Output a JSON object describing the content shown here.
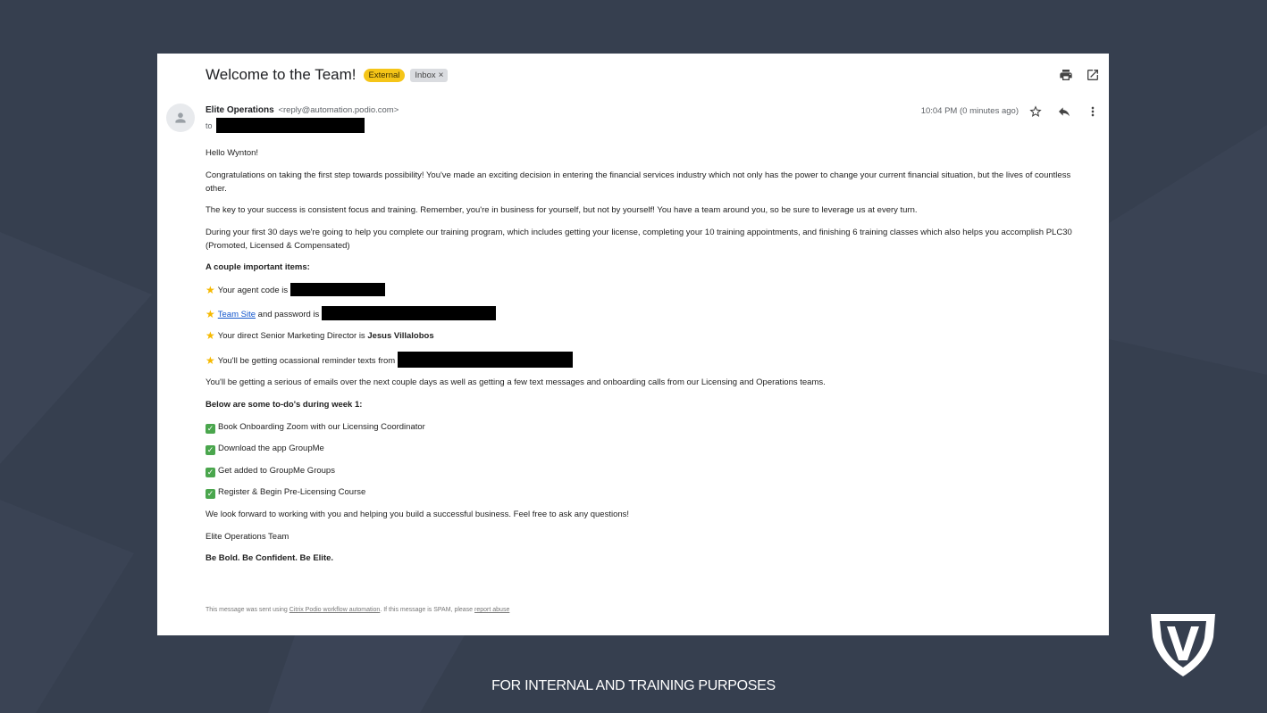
{
  "email": {
    "subject": "Welcome to the Team!",
    "badge_external": "External",
    "badge_inbox": "Inbox",
    "badge_inbox_close": "×",
    "sender_name": "Elite Operations",
    "sender_email": "<reply@automation.podio.com>",
    "to_label": "to",
    "timestamp": "10:04 PM (0 minutes ago)"
  },
  "body": {
    "greeting": "Hello Wynton!",
    "p1": "Congratulations on taking the first step towards possibility! You've made an exciting decision in entering the financial services industry which not only has the power to change your current financial situation, but the lives of countless other.",
    "p2": "The key to your success is consistent focus and training. Remember, you're in business for yourself, but not by yourself! You have a team around you, so be sure to leverage us at every turn.",
    "p3": "During your first 30 days we're going to help you complete our training program, which includes getting your license, completing your 10 training appointments, and finishing 6 training classes which also helps you accomplish PLC30 (Promoted, Licensed & Compensated)",
    "important_heading": "A couple important items:",
    "item_agent_code": "Your agent code is",
    "item_team_site_link": "Team Site",
    "item_team_site_rest": "and password is",
    "item_director_prefix": "Your direct Senior Marketing Director is",
    "item_director_name": "Jesus Villalobos",
    "item_texts": "You'll be getting ocassional reminder texts from",
    "p4": "You'll be getting a serious of emails over the next couple days as well as getting a few text messages and onboarding calls from our Licensing and Operations teams.",
    "todo_heading": "Below are some to-do's during week 1:",
    "todos": [
      "Book Onboarding Zoom with our Licensing Coordinator",
      "Download the app GroupMe",
      "Get added to GroupMe Groups",
      "Register & Begin Pre-Licensing Course"
    ],
    "closing": "We look forward to working with you and helping you build a successful business. Feel free to ask any questions!",
    "signature": "Elite Operations Team",
    "tagline": "Be Bold. Be Confident. Be Elite."
  },
  "footer": {
    "prefix": "This message was sent using",
    "link1": "Citrix Podio workflow automation",
    "middle": ". If this message is SPAM, please",
    "link2": "report abuse"
  },
  "caption": "FOR INTERNAL AND TRAINING PURPOSES",
  "icons": {
    "print": "print-icon",
    "open_new": "open-in-new-icon",
    "star": "star-icon",
    "reply": "reply-icon",
    "more": "more-vert-icon",
    "avatar": "person-icon",
    "logo": "shield-logo"
  },
  "colors": {
    "background": "#363f4f",
    "external_badge": "#f5c518",
    "link": "#1155cc"
  }
}
